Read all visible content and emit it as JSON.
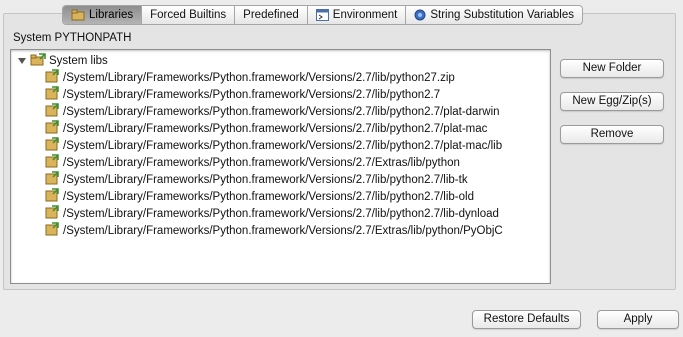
{
  "tabs": [
    {
      "label": "Libraries",
      "icon": "libraries-icon",
      "active": true
    },
    {
      "label": "Forced Builtins",
      "icon": null,
      "active": false
    },
    {
      "label": "Predefined",
      "icon": null,
      "active": false
    },
    {
      "label": "Environment",
      "icon": "environment-icon",
      "active": false
    },
    {
      "label": "String Substitution Variables",
      "icon": "variables-icon",
      "active": false
    }
  ],
  "section": {
    "label": "System PYTHONPATH"
  },
  "tree": {
    "root_label": "System libs",
    "items": [
      "/System/Library/Frameworks/Python.framework/Versions/2.7/lib/python27.zip",
      "/System/Library/Frameworks/Python.framework/Versions/2.7/lib/python2.7",
      "/System/Library/Frameworks/Python.framework/Versions/2.7/lib/python2.7/plat-darwin",
      "/System/Library/Frameworks/Python.framework/Versions/2.7/lib/python2.7/plat-mac",
      "/System/Library/Frameworks/Python.framework/Versions/2.7/lib/python2.7/plat-mac/lib",
      "/System/Library/Frameworks/Python.framework/Versions/2.7/Extras/lib/python",
      "/System/Library/Frameworks/Python.framework/Versions/2.7/lib/python2.7/lib-tk",
      "/System/Library/Frameworks/Python.framework/Versions/2.7/lib/python2.7/lib-old",
      "/System/Library/Frameworks/Python.framework/Versions/2.7/lib/python2.7/lib-dynload",
      "/System/Library/Frameworks/Python.framework/Versions/2.7/Extras/lib/python/PyObjC"
    ]
  },
  "buttons": {
    "new_folder": "New Folder",
    "new_egg": "New Egg/Zip(s)",
    "remove": "Remove",
    "restore_defaults": "Restore Defaults",
    "apply": "Apply"
  },
  "colors": {
    "panel": "#e4e4e4",
    "window": "#ececec",
    "folder": "#d9b45a",
    "arrow_green": "#3f8f2f"
  }
}
